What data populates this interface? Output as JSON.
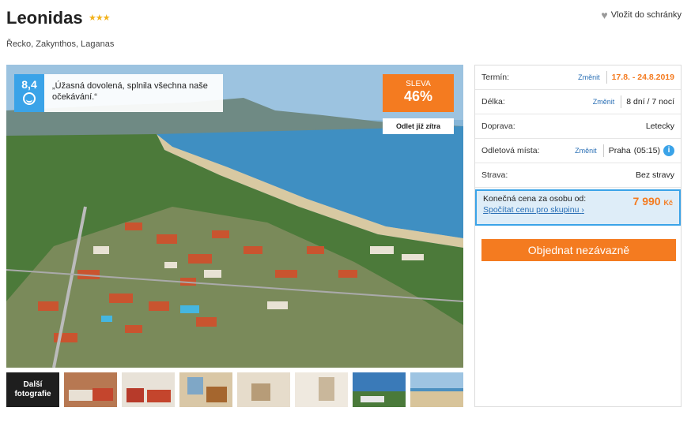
{
  "hotel": {
    "name": "Leonidas",
    "stars": "★★★",
    "location": "Řecko, Zakynthos, Laganas"
  },
  "favorite": {
    "icon": "heart-icon",
    "label": "Vložit do schránky"
  },
  "photo": {
    "rating": "8,4",
    "rating_icon": "smile-icon",
    "review_quote": "„Úžasná dovolená, splnila všechna naše očekávání.“",
    "sale_label": "SLEVA",
    "sale_percent": "46%",
    "departure_note": "Odlet již zítra"
  },
  "gallery": {
    "more_label": "Další fotografie",
    "thumbnail_count": 7
  },
  "details": {
    "rows": [
      {
        "label": "Termín:",
        "change": "Změnit",
        "value": "17.8. - 24.8.2019"
      },
      {
        "label": "Délka:",
        "change": "Změnit",
        "value": "8 dní / 7 nocí"
      },
      {
        "label": "Doprava:",
        "value": "Letecky"
      },
      {
        "label": "Odletová místa:",
        "change": "Změnit",
        "value": "Praha",
        "time": "(05:15)"
      },
      {
        "label": "Strava:",
        "value": "Bez stravy"
      }
    ],
    "price_label": "Konečná cena za osobu od:",
    "group_link": "Spočítat cenu pro skupinu",
    "price": "7 990",
    "currency": "Kč",
    "order_button": "Objednat nezávazně"
  },
  "colors": {
    "accent": "#f47b20",
    "blue": "#3aa3e8",
    "link": "#2a6fb5"
  }
}
